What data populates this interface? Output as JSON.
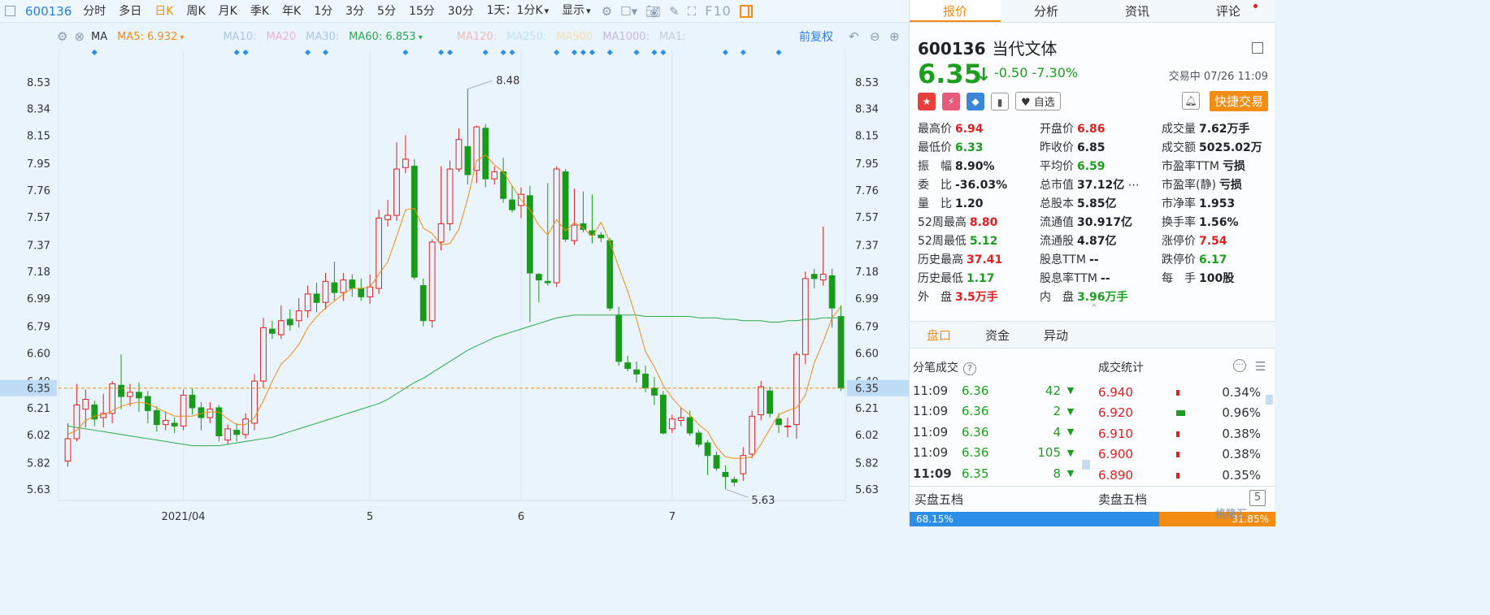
{
  "toolbar": {
    "code": "600136",
    "periods": [
      "分时",
      "多日",
      "日K",
      "周K",
      "月K",
      "季K",
      "年K",
      "1分",
      "3分",
      "5分",
      "15分",
      "30分"
    ],
    "active_period": "日K",
    "mode": "1天：1分K",
    "display": "显示",
    "f10": "F10"
  },
  "ma_legend": {
    "label": "MA",
    "ma5": "MA5: 6.932",
    "ma10": "MA10:",
    "ma20": "MA20",
    "ma30": "MA30:",
    "ma60": "MA60: 6.853",
    "ma120": "MA120:",
    "ma250": "MA250:",
    "ma500": "MA500",
    "ma1000": "MA1000:",
    "ma1": "MA1:",
    "adjust": "前复权"
  },
  "colors": {
    "up": "#e02020",
    "down": "#1a9a1a",
    "ma5": "#f28c12",
    "ma60": "#2aa84a",
    "accent": "#f28c12",
    "link": "#2b7de0"
  },
  "chart_data": {
    "type": "candlestick",
    "y_ticks": [
      "8.53",
      "8.34",
      "8.15",
      "7.95",
      "7.76",
      "7.57",
      "7.37",
      "7.18",
      "6.99",
      "6.79",
      "6.60",
      "6.40",
      "6.21",
      "6.02",
      "5.82",
      "5.63"
    ],
    "x_ticks": [
      {
        "label": "2021/04",
        "index": 13
      },
      {
        "label": "5",
        "index": 34
      },
      {
        "label": "6",
        "index": 51
      },
      {
        "label": "7",
        "index": 68
      }
    ],
    "current_price_label": "6.35",
    "current_price": 6.35,
    "ylim": [
      5.55,
      8.72
    ],
    "high_marker": {
      "label": "8.48",
      "index": 45
    },
    "low_marker": {
      "label": "5.63",
      "index": 74
    },
    "ohlc": [
      [
        5.83,
        5.99,
        5.79,
        6.1
      ],
      [
        5.99,
        6.23,
        5.97,
        6.38
      ],
      [
        6.2,
        6.27,
        6.07,
        6.34
      ],
      [
        6.23,
        6.13,
        6.08,
        6.26
      ],
      [
        6.14,
        6.17,
        6.07,
        6.31
      ],
      [
        6.17,
        6.38,
        6.1,
        6.4
      ],
      [
        6.37,
        6.29,
        6.2,
        6.59
      ],
      [
        6.29,
        6.32,
        6.22,
        6.38
      ],
      [
        6.32,
        6.28,
        6.18,
        6.39
      ],
      [
        6.29,
        6.19,
        6.1,
        6.33
      ],
      [
        6.19,
        6.09,
        6.04,
        6.22
      ],
      [
        6.09,
        6.12,
        6.05,
        6.18
      ],
      [
        6.1,
        6.08,
        6.03,
        6.14
      ],
      [
        6.08,
        6.3,
        6.05,
        6.34
      ],
      [
        6.3,
        6.21,
        6.16,
        6.35
      ],
      [
        6.21,
        6.14,
        6.05,
        6.25
      ],
      [
        6.14,
        6.2,
        6.1,
        6.25
      ],
      [
        6.21,
        6.01,
        5.97,
        6.23
      ],
      [
        5.98,
        6.06,
        5.95,
        6.09
      ],
      [
        6.05,
        6.02,
        5.97,
        6.1
      ],
      [
        6.02,
        6.13,
        5.99,
        6.17
      ],
      [
        6.1,
        6.4,
        6.05,
        6.45
      ],
      [
        6.4,
        6.78,
        6.35,
        6.85
      ],
      [
        6.77,
        6.74,
        6.7,
        6.83
      ],
      [
        6.73,
        6.83,
        6.7,
        6.94
      ],
      [
        6.84,
        6.8,
        6.76,
        6.91
      ],
      [
        6.83,
        6.9,
        6.78,
        6.99
      ],
      [
        6.9,
        7.02,
        6.85,
        7.08
      ],
      [
        7.02,
        6.96,
        6.89,
        7.1
      ],
      [
        6.96,
        7.11,
        6.91,
        7.17
      ],
      [
        7.1,
        7.03,
        6.97,
        7.25
      ],
      [
        7.03,
        7.12,
        6.97,
        7.17
      ],
      [
        7.12,
        7.06,
        7.0,
        7.16
      ],
      [
        7.06,
        7.0,
        6.97,
        7.13
      ],
      [
        7.0,
        7.07,
        6.95,
        7.16
      ],
      [
        7.06,
        7.56,
        7.02,
        7.62
      ],
      [
        7.55,
        7.58,
        7.5,
        7.69
      ],
      [
        7.58,
        7.91,
        7.54,
        8.1
      ],
      [
        7.92,
        7.98,
        7.88,
        8.15
      ],
      [
        7.93,
        7.14,
        7.12,
        7.98
      ],
      [
        7.08,
        6.83,
        6.79,
        7.13
      ],
      [
        6.83,
        7.39,
        6.78,
        7.41
      ],
      [
        7.39,
        7.52,
        7.33,
        7.93
      ],
      [
        7.52,
        7.91,
        7.47,
        7.97
      ],
      [
        7.91,
        8.12,
        7.89,
        8.2
      ],
      [
        8.07,
        7.87,
        7.8,
        8.48
      ],
      [
        7.9,
        8.21,
        7.81,
        8.22
      ],
      [
        8.2,
        7.84,
        7.78,
        8.23
      ],
      [
        7.84,
        7.89,
        7.8,
        7.93
      ],
      [
        7.89,
        7.7,
        7.67,
        7.99
      ],
      [
        7.69,
        7.62,
        7.6,
        7.79
      ],
      [
        7.65,
        7.73,
        7.56,
        7.78
      ],
      [
        7.72,
        7.17,
        6.82,
        7.79
      ],
      [
        7.16,
        7.12,
        6.96,
        7.17
      ],
      [
        7.11,
        7.1,
        7.08,
        7.81
      ],
      [
        7.1,
        7.91,
        7.07,
        7.93
      ],
      [
        7.89,
        7.41,
        7.39,
        7.91
      ],
      [
        7.4,
        7.51,
        7.37,
        7.77
      ],
      [
        7.52,
        7.48,
        7.46,
        7.75
      ],
      [
        7.47,
        7.44,
        7.38,
        7.73
      ],
      [
        7.44,
        7.42,
        7.39,
        7.46
      ],
      [
        7.4,
        6.92,
        6.9,
        7.42
      ],
      [
        6.87,
        6.54,
        6.51,
        6.93
      ],
      [
        6.53,
        6.49,
        6.47,
        6.58
      ],
      [
        6.48,
        6.45,
        6.39,
        6.54
      ],
      [
        6.45,
        6.35,
        6.32,
        6.51
      ],
      [
        6.35,
        6.3,
        6.23,
        6.43
      ],
      [
        6.3,
        6.03,
        6.02,
        6.33
      ],
      [
        6.06,
        6.13,
        6.03,
        6.16
      ],
      [
        6.12,
        6.14,
        6.08,
        6.21
      ],
      [
        6.14,
        6.03,
        6.01,
        6.19
      ],
      [
        6.03,
        5.95,
        5.93,
        6.05
      ],
      [
        5.96,
        5.87,
        5.73,
        5.98
      ],
      [
        5.87,
        5.78,
        5.76,
        5.9
      ],
      [
        5.75,
        5.72,
        5.63,
        5.8
      ],
      [
        5.7,
        5.68,
        5.65,
        5.72
      ],
      [
        5.74,
        5.87,
        5.69,
        5.93
      ],
      [
        5.88,
        6.15,
        5.85,
        6.19
      ],
      [
        6.16,
        6.36,
        6.12,
        6.4
      ],
      [
        6.33,
        6.17,
        6.14,
        6.36
      ],
      [
        6.13,
        6.09,
        6.03,
        6.17
      ],
      [
        6.08,
        6.08,
        6.0,
        6.14
      ],
      [
        6.09,
        6.59,
        5.99,
        6.61
      ],
      [
        6.59,
        7.13,
        6.52,
        7.18
      ],
      [
        7.16,
        7.13,
        7.06,
        7.2
      ],
      [
        7.12,
        7.16,
        7.08,
        7.5
      ],
      [
        7.15,
        6.92,
        6.78,
        7.2
      ],
      [
        6.86,
        6.35,
        6.33,
        6.94
      ]
    ],
    "ma5": [
      6.02,
      6.05,
      6.12,
      6.15,
      6.16,
      6.19,
      6.22,
      6.24,
      6.25,
      6.24,
      6.21,
      6.18,
      6.15,
      6.15,
      6.15,
      6.17,
      6.18,
      6.18,
      6.13,
      6.09,
      6.09,
      6.14,
      6.26,
      6.4,
      6.52,
      6.58,
      6.66,
      6.78,
      6.86,
      6.92,
      6.97,
      7.02,
      7.06,
      7.06,
      7.07,
      7.16,
      7.25,
      7.43,
      7.62,
      7.63,
      7.49,
      7.45,
      7.37,
      7.38,
      7.48,
      7.7,
      7.97,
      8.01,
      7.94,
      7.89,
      7.79,
      7.69,
      7.62,
      7.51,
      7.44,
      7.55,
      7.47,
      7.53,
      7.49,
      7.43,
      7.53,
      7.39,
      7.21,
      7.04,
      6.84,
      6.61,
      6.5,
      6.37,
      6.28,
      6.21,
      6.16,
      6.09,
      6.04,
      5.93,
      5.86,
      5.85,
      5.85,
      5.86,
      5.95,
      6.06,
      6.16,
      6.19,
      6.21,
      6.3,
      6.53,
      6.68,
      6.85,
      6.93
    ],
    "ma60": [
      6.08,
      6.07,
      6.06,
      6.05,
      6.04,
      6.03,
      6.02,
      6.01,
      6.0,
      5.99,
      5.98,
      5.97,
      5.96,
      5.95,
      5.94,
      5.94,
      5.94,
      5.94,
      5.95,
      5.96,
      5.97,
      5.98,
      5.99,
      6.0,
      6.02,
      6.04,
      6.06,
      6.08,
      6.1,
      6.12,
      6.14,
      6.16,
      6.18,
      6.2,
      6.22,
      6.24,
      6.27,
      6.31,
      6.35,
      6.39,
      6.42,
      6.46,
      6.5,
      6.54,
      6.58,
      6.62,
      6.65,
      6.68,
      6.71,
      6.73,
      6.75,
      6.77,
      6.79,
      6.81,
      6.83,
      6.85,
      6.86,
      6.87,
      6.87,
      6.87,
      6.87,
      6.87,
      6.87,
      6.87,
      6.87,
      6.86,
      6.86,
      6.86,
      6.86,
      6.86,
      6.86,
      6.85,
      6.85,
      6.85,
      6.84,
      6.84,
      6.83,
      6.83,
      6.83,
      6.82,
      6.82,
      6.83,
      6.83,
      6.84,
      6.84,
      6.85,
      6.85,
      6.85
    ]
  },
  "panel": {
    "tabs": [
      "报价",
      "分析",
      "资讯",
      "评论"
    ],
    "active_tab": "报价",
    "code": "600136",
    "name": "当代文体",
    "price": "6.35",
    "change": "-0.50",
    "change_pct": "-7.30%",
    "status": "交易中 07/26 11:09",
    "watch_label": "自选",
    "fast_trade": "快捷交易",
    "stats": [
      [
        {
          "l": "最高价",
          "v": "6.94",
          "c": "red"
        },
        {
          "l": "开盘价",
          "v": "6.86",
          "c": "red"
        },
        {
          "l": "成交量",
          "v": "7.62万手",
          "c": ""
        }
      ],
      [
        {
          "l": "最低价",
          "v": "6.33",
          "c": "green"
        },
        {
          "l": "昨收价",
          "v": "6.85",
          "c": ""
        },
        {
          "l": "成交额",
          "v": "5025.02万",
          "c": ""
        }
      ],
      [
        {
          "l": "振　幅",
          "v": "8.90%",
          "c": ""
        },
        {
          "l": "平均价",
          "v": "6.59",
          "c": "green"
        },
        {
          "l": "市盈率TTM",
          "v": "亏损",
          "c": ""
        }
      ],
      [
        {
          "l": "委　比",
          "v": "-36.03%",
          "c": ""
        },
        {
          "l": "总市值",
          "v": "37.12亿",
          "c": ""
        },
        {
          "l": "市盈率(静)",
          "v": "亏损",
          "c": ""
        }
      ],
      [
        {
          "l": "量　比",
          "v": "1.20",
          "c": ""
        },
        {
          "l": "总股本",
          "v": "5.85亿",
          "c": ""
        },
        {
          "l": "市净率",
          "v": "1.953",
          "c": ""
        }
      ],
      [
        {
          "l": "52周最高",
          "v": "8.80",
          "c": "red"
        },
        {
          "l": "流通值",
          "v": "30.917亿",
          "c": ""
        },
        {
          "l": "换手率",
          "v": "1.56%",
          "c": ""
        }
      ],
      [
        {
          "l": "52周最低",
          "v": "5.12",
          "c": "green"
        },
        {
          "l": "流通股",
          "v": "4.87亿",
          "c": ""
        },
        {
          "l": "涨停价",
          "v": "7.54",
          "c": "red"
        }
      ],
      [
        {
          "l": "历史最高",
          "v": "37.41",
          "c": "red"
        },
        {
          "l": "股息TTM",
          "v": "--",
          "c": ""
        },
        {
          "l": "跌停价",
          "v": "6.17",
          "c": "green"
        }
      ],
      [
        {
          "l": "历史最低",
          "v": "1.17",
          "c": "green"
        },
        {
          "l": "股息率TTM",
          "v": "--",
          "c": ""
        },
        {
          "l": "每　手",
          "v": "100股",
          "c": ""
        }
      ],
      [
        {
          "l": "外　盘",
          "v": "3.5万手",
          "c": "red"
        },
        {
          "l": "内　盘",
          "v": "3.96万手",
          "c": "green"
        },
        {
          "l": "",
          "v": "",
          "c": ""
        }
      ]
    ],
    "subtabs": [
      "盘口",
      "资金",
      "异动"
    ],
    "active_subtab": "盘口",
    "trades_title": "分笔成交",
    "trades": [
      {
        "t": "11:09",
        "p": "6.36",
        "v": "42"
      },
      {
        "t": "11:09",
        "p": "6.36",
        "v": "2"
      },
      {
        "t": "11:09",
        "p": "6.36",
        "v": "4"
      },
      {
        "t": "11:09",
        "p": "6.36",
        "v": "105"
      },
      {
        "t": "11:09",
        "p": "6.35",
        "v": "8"
      }
    ],
    "vol_title": "成交统计",
    "vol": [
      {
        "p": "6.940",
        "pct": "0.34%",
        "share": 0.34,
        "g": false
      },
      {
        "p": "6.920",
        "pct": "0.96%",
        "share": 0.96,
        "g": true
      },
      {
        "p": "6.910",
        "pct": "0.38%",
        "share": 0.38,
        "g": false
      },
      {
        "p": "6.900",
        "pct": "0.38%",
        "share": 0.38,
        "g": false
      },
      {
        "p": "6.890",
        "pct": "0.35%",
        "share": 0.35,
        "g": false
      }
    ],
    "buy5": "买盘五档",
    "sell5": "卖盘五档",
    "buy_ratio": "68.15%",
    "buy_share": 68.15,
    "sell_ratio": "31.85%"
  },
  "watermark": "格隆汇"
}
